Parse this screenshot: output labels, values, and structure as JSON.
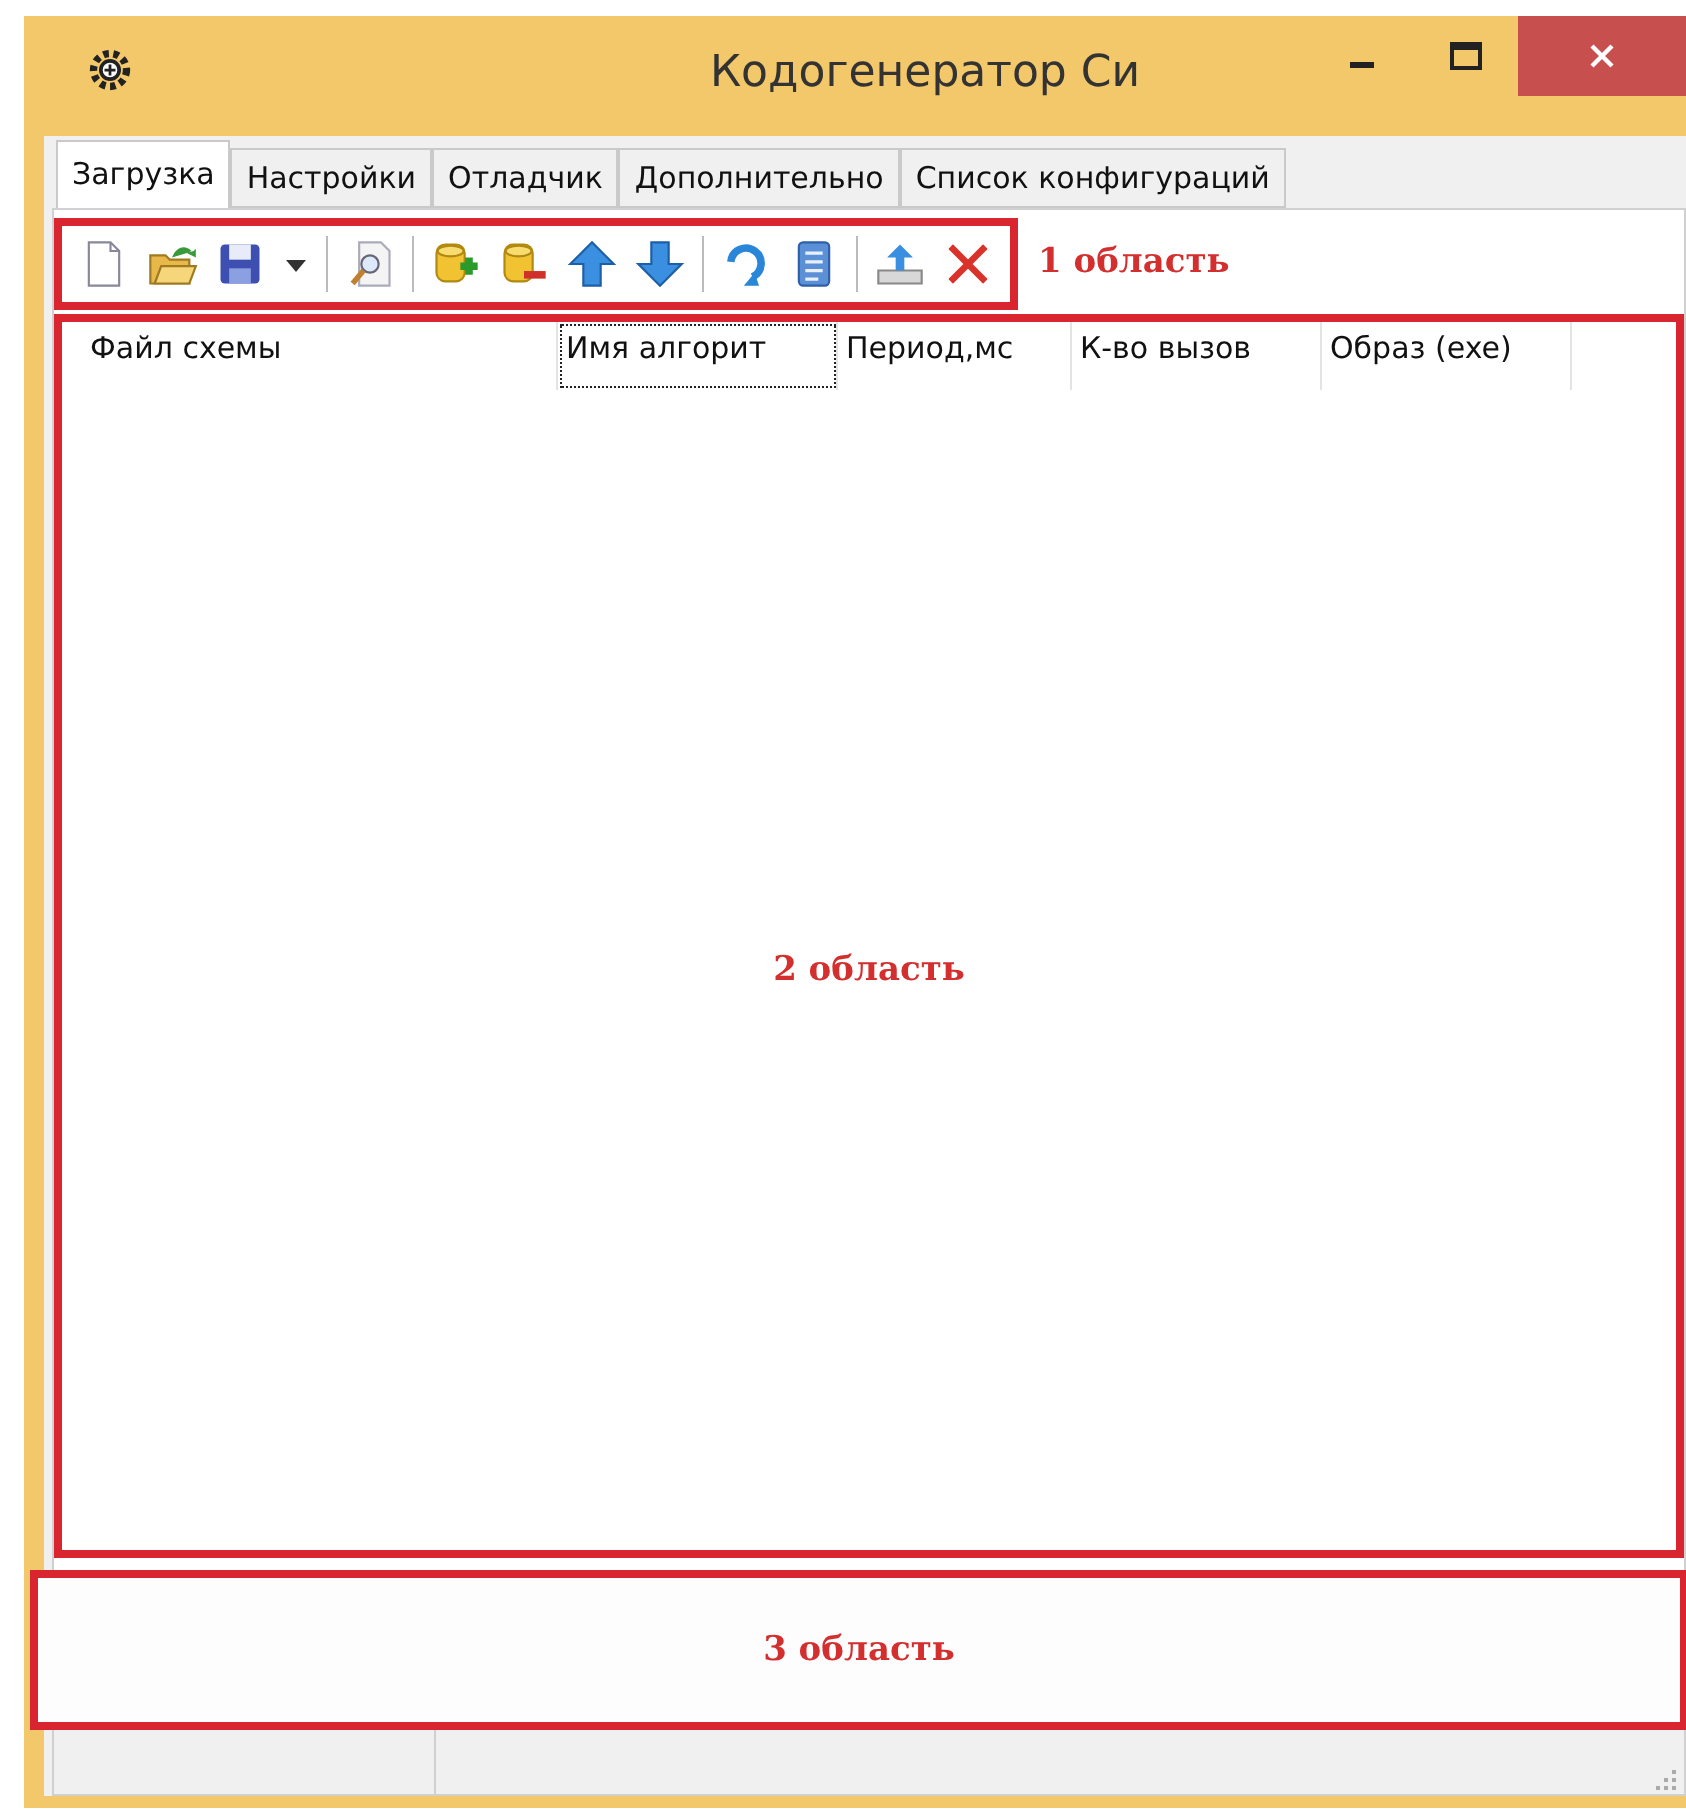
{
  "window": {
    "title": "Кодогенератор Си"
  },
  "tabs": [
    {
      "label": "Загрузка",
      "selected": true
    },
    {
      "label": "Настройки",
      "selected": false
    },
    {
      "label": "Отладчик",
      "selected": false
    },
    {
      "label": "Дополнительно",
      "selected": false
    },
    {
      "label": "Список конфигураций",
      "selected": false
    }
  ],
  "table": {
    "columns": [
      {
        "label": "Файл схемы",
        "focused": false
      },
      {
        "label": "Имя алгорит",
        "focused": true
      },
      {
        "label": "Период,мс",
        "focused": false
      },
      {
        "label": "К-во вызов",
        "focused": false
      },
      {
        "label": "Образ (exe)",
        "focused": false
      }
    ]
  },
  "annotations": [
    "1 область",
    "2 область",
    "3 область"
  ]
}
